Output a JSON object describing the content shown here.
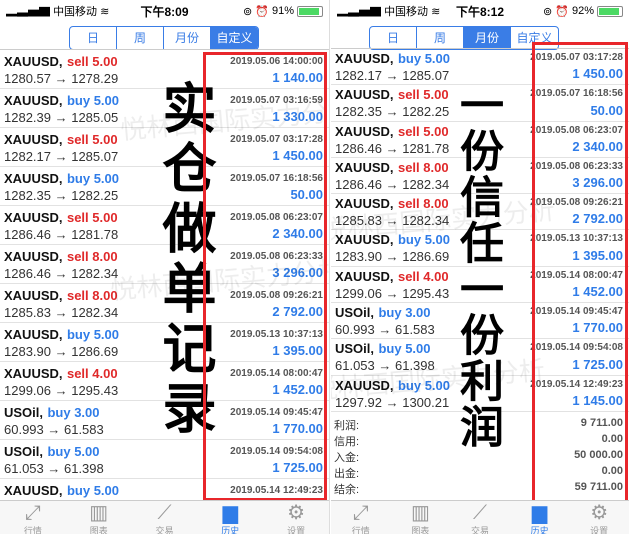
{
  "left": {
    "status": {
      "carrier": "中国移动",
      "time": "下午8:09",
      "battery": "91%",
      "battery_level": 0.91
    },
    "segments": [
      "日",
      "周",
      "月份",
      "自定义"
    ],
    "active_segment": 3,
    "rows": [
      {
        "symbol": "XAUUSD,",
        "side": "sell 5.00",
        "type": "sell",
        "prices": "1280.57 → 1278.29",
        "time": "2019.05.06 14:00:00",
        "profit": "1 140.00"
      },
      {
        "symbol": "XAUUSD,",
        "side": "buy 5.00",
        "type": "buy",
        "prices": "1282.39 → 1285.05",
        "time": "2019.05.07 03:16:59",
        "profit": "1 330.00"
      },
      {
        "symbol": "XAUUSD,",
        "side": "sell 5.00",
        "type": "sell",
        "prices": "1282.17 → 1285.07",
        "time": "2019.05.07 03:17:28",
        "profit": "1 450.00"
      },
      {
        "symbol": "XAUUSD,",
        "side": "buy 5.00",
        "type": "buy",
        "prices": "1282.35 → 1282.25",
        "time": "2019.05.07 16:18:56",
        "profit": "50.00"
      },
      {
        "symbol": "XAUUSD,",
        "side": "sell 5.00",
        "type": "sell",
        "prices": "1286.46 → 1281.78",
        "time": "2019.05.08 06:23:07",
        "profit": "2 340.00"
      },
      {
        "symbol": "XAUUSD,",
        "side": "sell 8.00",
        "type": "sell",
        "prices": "1286.46 → 1282.34",
        "time": "2019.05.08 06:23:33",
        "profit": "3 296.00"
      },
      {
        "symbol": "XAUUSD,",
        "side": "sell 8.00",
        "type": "sell",
        "prices": "1285.83 → 1282.34",
        "time": "2019.05.08 09:26:21",
        "profit": "2 792.00"
      },
      {
        "symbol": "XAUUSD,",
        "side": "buy 5.00",
        "type": "buy",
        "prices": "1283.90 → 1286.69",
        "time": "2019.05.13 10:37:13",
        "profit": "1 395.00"
      },
      {
        "symbol": "XAUUSD,",
        "side": "sell 4.00",
        "type": "sell",
        "prices": "1299.06 → 1295.43",
        "time": "2019.05.14 08:00:47",
        "profit": "1 452.00"
      },
      {
        "symbol": "USOil,",
        "side": "buy 3.00",
        "type": "buy",
        "prices": "60.993 → 61.583",
        "time": "2019.05.14 09:45:47",
        "profit": "1 770.00"
      },
      {
        "symbol": "USOil,",
        "side": "buy 5.00",
        "type": "buy",
        "prices": "61.053 → 61.398",
        "time": "2019.05.14 09:54:08",
        "profit": "1 725.00"
      },
      {
        "symbol": "XAUUSD,",
        "side": "buy 5.00",
        "type": "buy",
        "prices": "",
        "time": "2019.05.14 12:49:23",
        "profit": ""
      }
    ],
    "overlay_text": "实仓做单记录"
  },
  "right": {
    "status": {
      "carrier": "中国移动",
      "time": "下午8:12",
      "battery": "92%",
      "battery_level": 0.92
    },
    "segments": [
      "日",
      "周",
      "月份",
      "自定义"
    ],
    "active_segment": 2,
    "rows": [
      {
        "symbol": "XAUUSD,",
        "side": "buy 5.00",
        "type": "buy",
        "prices": "1282.17 → 1285.07",
        "time": "2019.05.07 03:17:28",
        "profit": "1 450.00"
      },
      {
        "symbol": "XAUUSD,",
        "side": "sell 5.00",
        "type": "sell",
        "prices": "1282.35 → 1282.25",
        "time": "2019.05.07 16:18:56",
        "profit": "50.00"
      },
      {
        "symbol": "XAUUSD,",
        "side": "sell 5.00",
        "type": "sell",
        "prices": "1286.46 → 1281.78",
        "time": "2019.05.08 06:23:07",
        "profit": "2 340.00"
      },
      {
        "symbol": "XAUUSD,",
        "side": "sell 8.00",
        "type": "sell",
        "prices": "1286.46 → 1282.34",
        "time": "2019.05.08 06:23:33",
        "profit": "3 296.00"
      },
      {
        "symbol": "XAUUSD,",
        "side": "sell 8.00",
        "type": "sell",
        "prices": "1285.83 → 1282.34",
        "time": "2019.05.08 09:26:21",
        "profit": "2 792.00"
      },
      {
        "symbol": "XAUUSD,",
        "side": "buy 5.00",
        "type": "buy",
        "prices": "1283.90 → 1286.69",
        "time": "2019.05.13 10:37:13",
        "profit": "1 395.00"
      },
      {
        "symbol": "XAUUSD,",
        "side": "sell 4.00",
        "type": "sell",
        "prices": "1299.06 → 1295.43",
        "time": "2019.05.14 08:00:47",
        "profit": "1 452.00"
      },
      {
        "symbol": "USOil,",
        "side": "buy 3.00",
        "type": "buy",
        "prices": "60.993 → 61.583",
        "time": "2019.05.14 09:45:47",
        "profit": "1 770.00"
      },
      {
        "symbol": "USOil,",
        "side": "buy 5.00",
        "type": "buy",
        "prices": "61.053 → 61.398",
        "time": "2019.05.14 09:54:08",
        "profit": "1 725.00"
      },
      {
        "symbol": "XAUUSD,",
        "side": "buy 5.00",
        "type": "buy",
        "prices": "1297.92 → 1300.21",
        "time": "2019.05.14 12:49:23",
        "profit": "1 145.00"
      }
    ],
    "summary": [
      {
        "label": "利润:",
        "value": "9 711.00"
      },
      {
        "label": "信用:",
        "value": "0.00"
      },
      {
        "label": "入金:",
        "value": "50 000.00"
      },
      {
        "label": "出金:",
        "value": "0.00"
      },
      {
        "label": "结余:",
        "value": "59 711.00"
      }
    ],
    "overlay_text": "一份信任一份利润"
  },
  "tabbar": [
    {
      "label": "行情",
      "icon": "quotes-arrows-icon"
    },
    {
      "label": "图表",
      "icon": "candlestick-chart-icon"
    },
    {
      "label": "交易",
      "icon": "trade-chart-icon"
    },
    {
      "label": "历史",
      "icon": "history-inbox-icon"
    },
    {
      "label": "设置",
      "icon": "gear-icon"
    }
  ],
  "active_tab": 3,
  "watermark": "悦林西国际实力分析",
  "colors": {
    "accent": "#3a7de6",
    "buy": "#2f7ce8",
    "sell": "#e0292a",
    "highlight_box": "#e8262b"
  }
}
